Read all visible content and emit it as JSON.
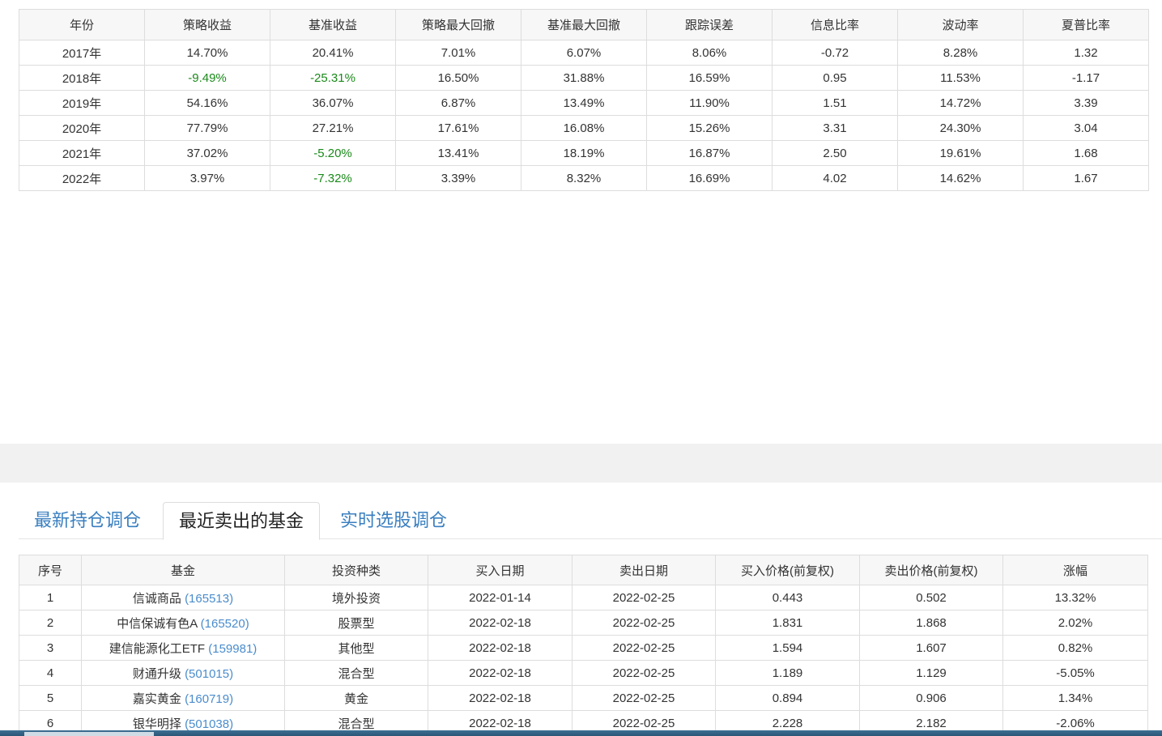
{
  "performance": {
    "headers": [
      "年份",
      "策略收益",
      "基准收益",
      "策略最大回撤",
      "基准最大回撤",
      "跟踪误差",
      "信息比率",
      "波动率",
      "夏普比率"
    ],
    "rows": [
      [
        "2017年",
        "14.70%",
        "20.41%",
        "7.01%",
        "6.07%",
        "8.06%",
        "-0.72",
        "8.28%",
        "1.32"
      ],
      [
        "2018年",
        "-9.49%",
        "-25.31%",
        "16.50%",
        "31.88%",
        "16.59%",
        "0.95",
        "11.53%",
        "-1.17"
      ],
      [
        "2019年",
        "54.16%",
        "36.07%",
        "6.87%",
        "13.49%",
        "11.90%",
        "1.51",
        "14.72%",
        "3.39"
      ],
      [
        "2020年",
        "77.79%",
        "27.21%",
        "17.61%",
        "16.08%",
        "15.26%",
        "3.31",
        "24.30%",
        "3.04"
      ],
      [
        "2021年",
        "37.02%",
        "-5.20%",
        "13.41%",
        "18.19%",
        "16.87%",
        "2.50",
        "19.61%",
        "1.68"
      ],
      [
        "2022年",
        "3.97%",
        "-7.32%",
        "3.39%",
        "8.32%",
        "16.69%",
        "4.02",
        "14.62%",
        "1.67"
      ]
    ]
  },
  "tabs": [
    {
      "label": "最新持仓调仓"
    },
    {
      "label": "最近卖出的基金",
      "active": true
    },
    {
      "label": "实时选股调仓"
    }
  ],
  "sold": {
    "headers": [
      "序号",
      "基金",
      "投资种类",
      "买入日期",
      "卖出日期",
      "买入价格(前复权)",
      "卖出价格(前复权)",
      "涨幅"
    ],
    "rows": [
      {
        "no": "1",
        "name": "信诚商品",
        "code": "(165513)",
        "type": "境外投资",
        "buy": "2022-01-14",
        "sell": "2022-02-25",
        "bp": "0.443",
        "sp": "0.502",
        "chg": "13.32%"
      },
      {
        "no": "2",
        "name": "中信保诚有色A",
        "code": "(165520)",
        "type": "股票型",
        "buy": "2022-02-18",
        "sell": "2022-02-25",
        "bp": "1.831",
        "sp": "1.868",
        "chg": "2.02%"
      },
      {
        "no": "3",
        "name": "建信能源化工ETF",
        "code": "(159981)",
        "type": "其他型",
        "buy": "2022-02-18",
        "sell": "2022-02-25",
        "bp": "1.594",
        "sp": "1.607",
        "chg": "0.82%"
      },
      {
        "no": "4",
        "name": "财通升级",
        "code": "(501015)",
        "type": "混合型",
        "buy": "2022-02-18",
        "sell": "2022-02-25",
        "bp": "1.189",
        "sp": "1.129",
        "chg": "-5.05%"
      },
      {
        "no": "5",
        "name": "嘉实黄金",
        "code": "(160719)",
        "type": "黄金",
        "buy": "2022-02-18",
        "sell": "2022-02-25",
        "bp": "0.894",
        "sp": "0.906",
        "chg": "1.34%"
      },
      {
        "no": "6",
        "name": "银华明择",
        "code": "(501038)",
        "type": "混合型",
        "buy": "2022-02-18",
        "sell": "2022-02-25",
        "bp": "2.228",
        "sp": "2.182",
        "chg": "-2.06%"
      }
    ]
  },
  "colors": {
    "negative": "#1a8a1a",
    "link": "#3a7fc0"
  }
}
